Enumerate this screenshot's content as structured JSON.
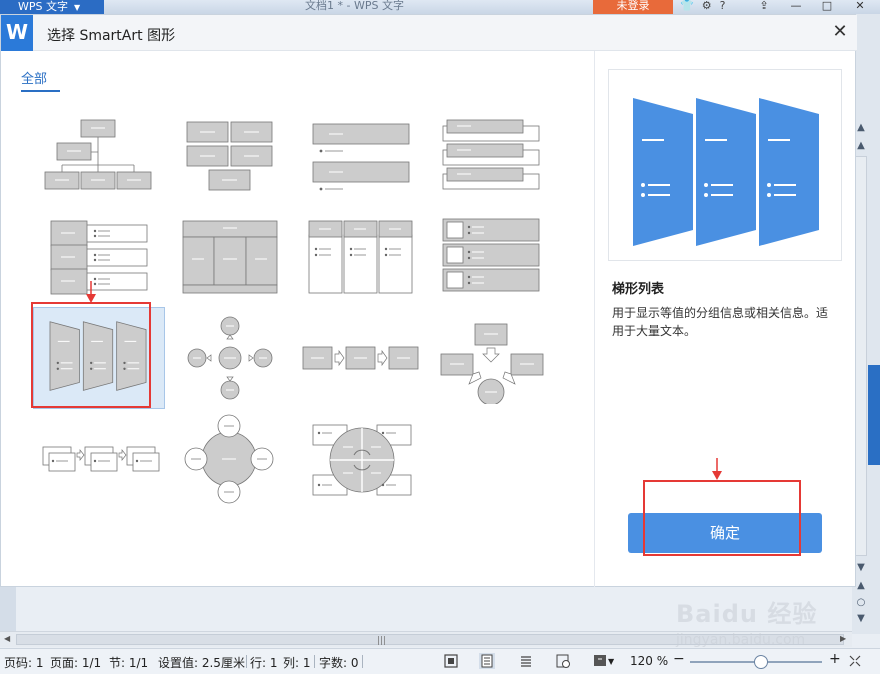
{
  "app": {
    "name": "WPS 文字",
    "document_title": "文档1 * - WPS 文字",
    "login_label": "未登录",
    "help_label": "?"
  },
  "dialog": {
    "title": "选择 SmartArt 图形",
    "close_label": "✕",
    "tab_label": "全部",
    "selected_index": 8,
    "preview": {
      "name": "梯形列表",
      "description": "用于显示等值的分组信息或相关信息。适用于大量文本。"
    },
    "ok_label": "确定"
  },
  "statusbar": {
    "page_code": "页码: 1",
    "page": "页面: 1/1",
    "section": "节: 1/1",
    "setting": "设置值: 2.5厘米",
    "row": "行: 1",
    "col": "列: 1",
    "word_count": "字数: 0",
    "zoom": "120 %",
    "zoom_level_percent": 120
  },
  "watermark": {
    "main": "Baidu 经验",
    "sub": "jingyan.baidu.com"
  },
  "colors": {
    "accent": "#4a90e2",
    "brand": "#2b7ad9",
    "highlight_red": "#e53935",
    "shape_fill": "#cccccc",
    "preview_fill": "#4a90e2"
  }
}
